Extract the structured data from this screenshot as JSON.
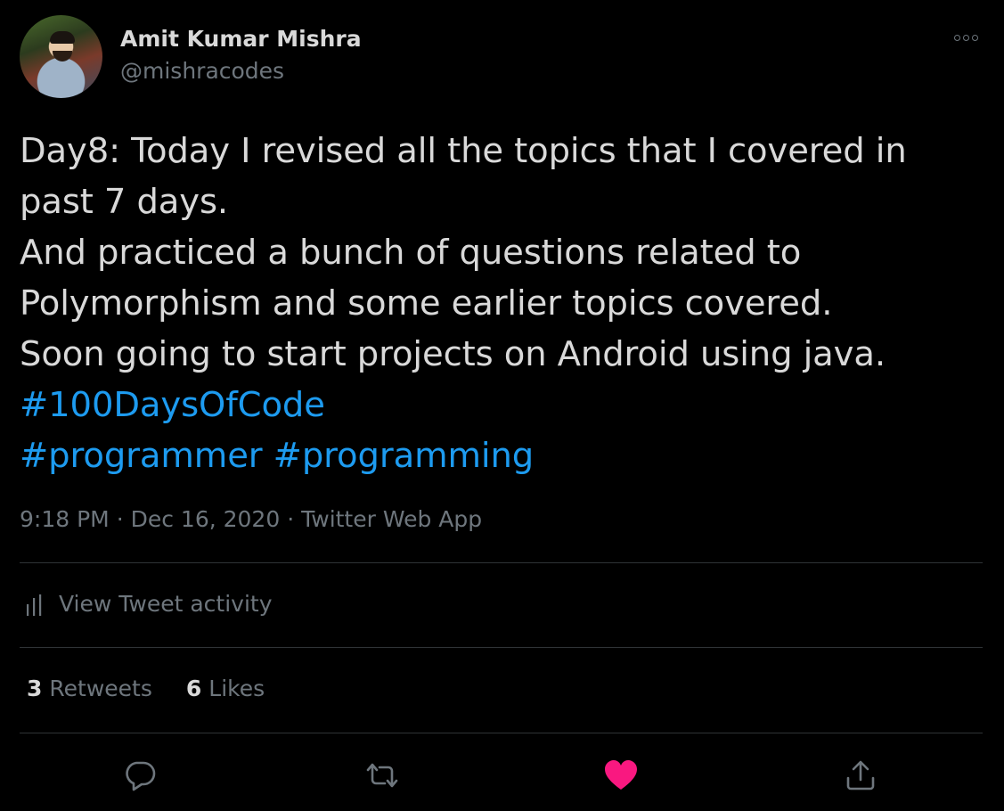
{
  "author": {
    "name": "Amit Kumar Mishra",
    "handle": "@mishracodes"
  },
  "tweet": {
    "lines": [
      "Day8: Today I revised all the topics that I covered in",
      "past 7 days.",
      "And practiced a bunch of questions related to",
      "Polymorphism and some earlier topics covered.",
      "Soon going to start projects on Android using java."
    ],
    "hashtags": [
      "#100DaysOfCode",
      "#programmer",
      "#programming"
    ]
  },
  "meta": {
    "time": "9:18 PM",
    "date": "Dec 16, 2020",
    "source": "Twitter Web App",
    "separator": "·"
  },
  "activity": {
    "label": "View Tweet activity",
    "icon": "bar-chart-icon"
  },
  "stats": {
    "retweets_count": "3",
    "retweets_label": "Retweets",
    "likes_count": "6",
    "likes_label": "Likes"
  },
  "actions": [
    {
      "name": "reply",
      "icon": "comment-icon"
    },
    {
      "name": "retweet",
      "icon": "retweet-icon"
    },
    {
      "name": "like",
      "icon": "heart-icon",
      "liked": true
    },
    {
      "name": "share",
      "icon": "share-icon"
    }
  ],
  "colors": {
    "background": "#000000",
    "text": "#d9d9d9",
    "muted": "#6e767d",
    "link": "#1d9bf0",
    "like": "#f91880",
    "divider": "#2f3336"
  }
}
